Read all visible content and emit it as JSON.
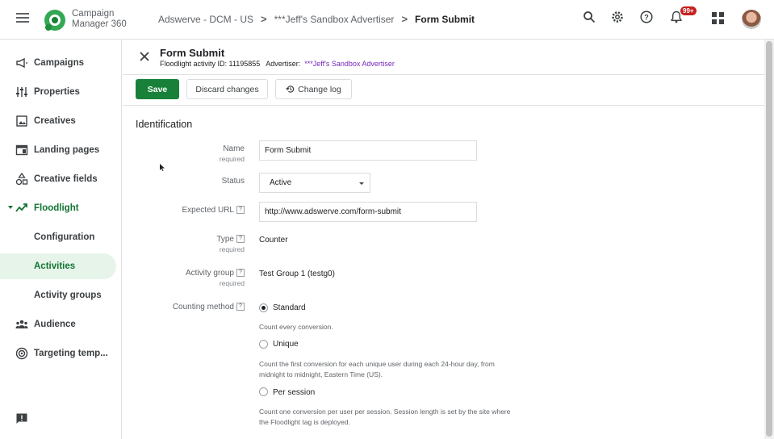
{
  "app": {
    "brand_line1": "Campaign",
    "brand_line2": "Manager 360"
  },
  "breadcrumb": [
    "Adswerve - DCM - US",
    "***Jeff's Sandbox Advertiser",
    "Form Submit"
  ],
  "notifications_badge": "99+",
  "sidebar": {
    "items": [
      {
        "label": "Campaigns",
        "icon": "megaphone-icon"
      },
      {
        "label": "Properties",
        "icon": "sliders-icon"
      },
      {
        "label": "Creatives",
        "icon": "image-icon"
      },
      {
        "label": "Landing pages",
        "icon": "web-icon"
      },
      {
        "label": "Creative fields",
        "icon": "shapes-icon"
      },
      {
        "label": "Floodlight",
        "icon": "trend-icon"
      },
      {
        "label": "Configuration"
      },
      {
        "label": "Activities"
      },
      {
        "label": "Activity groups"
      },
      {
        "label": "Audience",
        "icon": "people-icon"
      },
      {
        "label": "Targeting temp...",
        "icon": "target-icon"
      }
    ]
  },
  "header": {
    "title": "Form Submit",
    "activity_id_label": "Floodlight activity ID: 11195855",
    "advertiser_label": "Advertiser:",
    "advertiser_link": "***Jeff's Sandbox Advertiser"
  },
  "toolbar": {
    "save": "Save",
    "discard": "Discard changes",
    "changelog": "Change log"
  },
  "form": {
    "section_title": "Identification",
    "required": "required",
    "name_label": "Name",
    "name_value": "Form Submit",
    "status_label": "Status",
    "status_value": "Active",
    "url_label": "Expected URL",
    "url_value": "http://www.adswerve.com/form-submit",
    "type_label": "Type",
    "type_value": "Counter",
    "group_label": "Activity group",
    "group_value": "Test Group 1 (testg0)",
    "counting_label": "Counting method",
    "help": "?",
    "options": [
      {
        "label": "Standard",
        "desc": "Count every conversion.",
        "checked": true
      },
      {
        "label": "Unique",
        "desc": "Count the first conversion for each unique user during each 24-hour day, from midnight to midnight, Eastern Time (US).",
        "checked": false
      },
      {
        "label": "Per session",
        "desc": "Count one conversion per user per session. Session length is set by the site where the Floodlight tag is deployed.",
        "checked": false
      }
    ]
  },
  "colors": {
    "accent": "#137333",
    "save_button": "#188038",
    "link": "#7627bb",
    "badge": "#c5221f"
  }
}
